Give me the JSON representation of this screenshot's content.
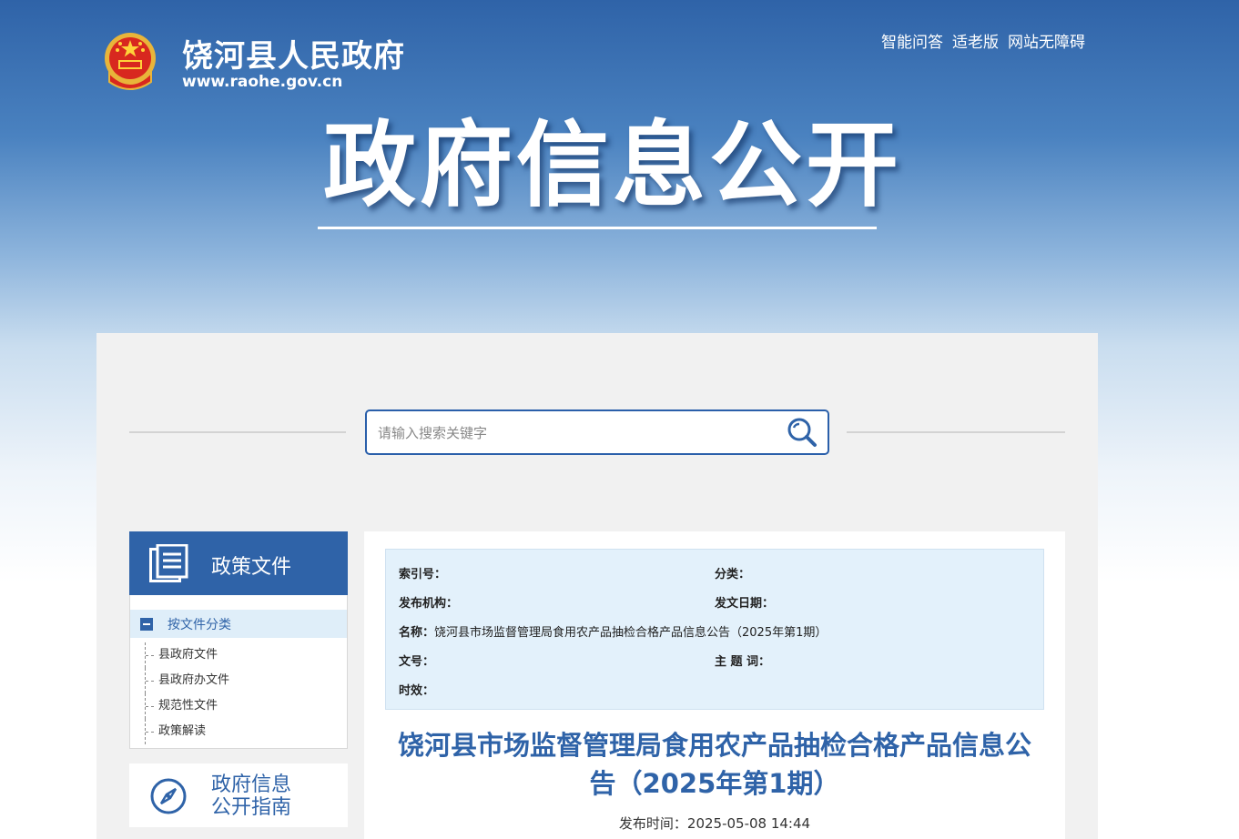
{
  "header": {
    "site_name": "饶河县人民政府",
    "site_url": "www.raohe.gov.cn",
    "top_links": [
      "智能问答",
      "适老版",
      "网站无障碍"
    ],
    "banner_title": "政府信息公开"
  },
  "search": {
    "placeholder": "请输入搜索关键字"
  },
  "sidebar": {
    "section_title": "政策文件",
    "category_label": "按文件分类",
    "items": [
      "县政府文件",
      "县政府办文件",
      "规范性文件",
      "政策解读"
    ],
    "guide_title_line1": "政府信息",
    "guide_title_line2": "公开指南"
  },
  "meta": {
    "index_no_label": "索引号：",
    "category_label": "分类：",
    "publisher_label": "发布机构：",
    "issue_date_label": "发文日期：",
    "name_label": "名称：",
    "name_value": "饶河县市场监督管理局食用农产品抽检合格产品信息公告（2025年第1期）",
    "doc_no_label": "文号：",
    "keywords_label": "主 题 词：",
    "validity_label": "时效："
  },
  "article": {
    "title": "饶河县市场监督管理局食用农产品抽检合格产品信息公告（2025年第1期）",
    "publish_time": "发布时间：2025-05-08 14:44"
  },
  "colors": {
    "brand_blue": "#2f63a8",
    "meta_bg": "#e3f1fb"
  }
}
